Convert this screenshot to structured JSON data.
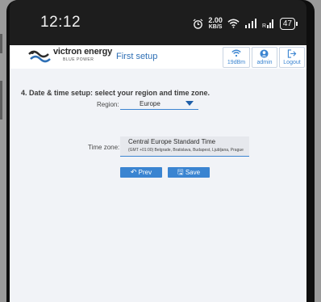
{
  "status_bar": {
    "time": "12:12",
    "speed_value": "2.00",
    "speed_unit": "KB/S",
    "battery": "47",
    "icons": [
      "alarm-icon",
      "wifi-icon",
      "signal-icon",
      "signal-r-icon",
      "battery-icon"
    ]
  },
  "header": {
    "logo_text": "victron energy",
    "logo_sub": "BLUE POWER",
    "page_title": "First setup",
    "wifi_label": "19dBm",
    "admin_label": "admin",
    "logout_label": "Logout"
  },
  "form": {
    "step_title": "4. Date & time setup: select your region and time zone.",
    "region_label": "Region:",
    "region_value": "Europe",
    "timezone_label": "Time zone:",
    "timezone_value": "Central Europe Standard Time",
    "timezone_detail": "(GMT +01:00) Belgrade, Bratislava, Budapest, Ljubljana, Prague"
  },
  "buttons": {
    "prev_label": "Prev",
    "save_label": "Save"
  },
  "colors": {
    "accent": "#3a84d1",
    "heading": "#2e6fb5",
    "background": "#f1f3f7"
  }
}
